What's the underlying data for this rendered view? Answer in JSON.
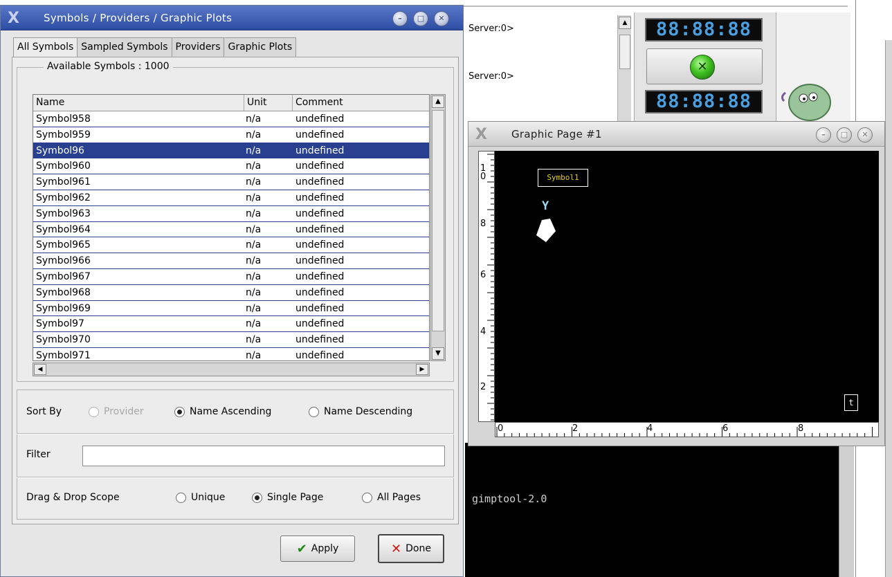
{
  "background": {
    "server_lines": [
      "Server:0>",
      "Server:0>"
    ],
    "clock_top": "88:88:88",
    "clock_bottom": "88:88:88",
    "terminal_text": "gimptool-2.0"
  },
  "dialog": {
    "title": "Symbols / Providers / Graphic Plots",
    "tabs": [
      "All Symbols",
      "Sampled Symbols",
      "Providers",
      "Graphic Plots"
    ],
    "available_label": "Available Symbols : 1000",
    "columns": [
      "Name",
      "Unit",
      "Comment"
    ],
    "rows": [
      {
        "name": "Symbol958",
        "unit": "n/a",
        "comment": "undefined"
      },
      {
        "name": "Symbol959",
        "unit": "n/a",
        "comment": "undefined"
      },
      {
        "name": "Symbol96",
        "unit": "n/a",
        "comment": "undefined",
        "selected": true
      },
      {
        "name": "Symbol960",
        "unit": "n/a",
        "comment": "undefined"
      },
      {
        "name": "Symbol961",
        "unit": "n/a",
        "comment": "undefined"
      },
      {
        "name": "Symbol962",
        "unit": "n/a",
        "comment": "undefined"
      },
      {
        "name": "Symbol963",
        "unit": "n/a",
        "comment": "undefined"
      },
      {
        "name": "Symbol964",
        "unit": "n/a",
        "comment": "undefined"
      },
      {
        "name": "Symbol965",
        "unit": "n/a",
        "comment": "undefined"
      },
      {
        "name": "Symbol966",
        "unit": "n/a",
        "comment": "undefined"
      },
      {
        "name": "Symbol967",
        "unit": "n/a",
        "comment": "undefined"
      },
      {
        "name": "Symbol968",
        "unit": "n/a",
        "comment": "undefined"
      },
      {
        "name": "Symbol969",
        "unit": "n/a",
        "comment": "undefined"
      },
      {
        "name": "Symbol97",
        "unit": "n/a",
        "comment": "undefined"
      },
      {
        "name": "Symbol970",
        "unit": "n/a",
        "comment": "undefined"
      },
      {
        "name": "Symbol971",
        "unit": "n/a",
        "comment": "undefined"
      }
    ],
    "sort": {
      "label": "Sort By",
      "options": [
        "Provider",
        "Name Ascending",
        "Name Descending"
      ],
      "selected": "Name Ascending"
    },
    "filter": {
      "label": "Filter",
      "value": ""
    },
    "scope": {
      "label": "Drag & Drop Scope",
      "options": [
        "Unique",
        "Single Page",
        "All Pages"
      ],
      "selected": "Single Page"
    },
    "apply_label": "Apply",
    "done_label": "Done"
  },
  "graphic_page": {
    "title": "Graphic Page #1",
    "symbol_label": "Symbol1",
    "y_marker": "Y",
    "t_marker": "t",
    "y_ruler_labels": [
      "1",
      "0",
      "8",
      "6",
      "4",
      "2"
    ],
    "x_ruler_labels": [
      "0",
      "2",
      "4",
      "6",
      "8"
    ]
  },
  "colors": {
    "title_bar": "#3a5cb4",
    "selection": "#28408f",
    "canvas": "#000000",
    "lcd": "#4a9fe0"
  }
}
